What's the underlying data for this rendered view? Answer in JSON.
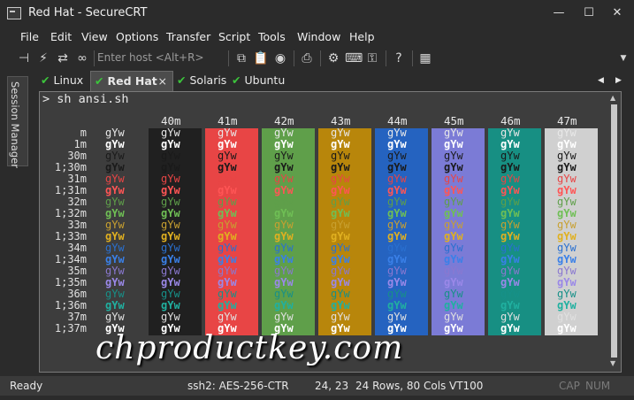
{
  "window": {
    "title": "Red Hat - SecureCRT"
  },
  "menu": [
    "File",
    "Edit",
    "View",
    "Options",
    "Transfer",
    "Script",
    "Tools",
    "Window",
    "Help"
  ],
  "toolbar": {
    "host_placeholder": "Enter host <Alt+R>"
  },
  "tabs": [
    {
      "label": "Linux",
      "active": false
    },
    {
      "label": "Red Hat",
      "active": true
    },
    {
      "label": "Solaris",
      "active": false
    },
    {
      "label": "Ubuntu",
      "active": false
    }
  ],
  "tab_close_glyph": "×",
  "side_panel": {
    "label": "Session Manager"
  },
  "terminal": {
    "prompt": "> sh ansi.sh",
    "sample": "gYw",
    "columns": [
      "40m",
      "41m",
      "42m",
      "43m",
      "44m",
      "45m",
      "46m",
      "47m"
    ],
    "column_colors": [
      "#202020",
      "#e84545",
      "#5f9f4a",
      "#b8860b",
      "#2563c0",
      "#7b7bd6",
      "#178f83",
      "#d0d0d0"
    ],
    "rows": [
      "m",
      "1m",
      "30m",
      "1;30m",
      "31m",
      "1;31m",
      "32m",
      "1;32m",
      "33m",
      "1;33m",
      "34m",
      "1;34m",
      "35m",
      "1;35m",
      "36m",
      "1;36m",
      "37m",
      "1;37m"
    ],
    "fg_colors": [
      "#e8e8e8",
      "#ffffff",
      "#1a1a1a",
      "#1a1a1a",
      "#e84545",
      "#ff5555",
      "#5f9f4a",
      "#6fbf55",
      "#c8a030",
      "#e0b020",
      "#2a70d0",
      "#3a80e8",
      "#8a78d0",
      "#9a88e8",
      "#179088",
      "#20b0a0",
      "#e0e0e0",
      "#ffffff"
    ]
  },
  "watermark": "chproductkey.com",
  "status": {
    "ready": "Ready",
    "cipher": "ssh2: AES-256-CTR",
    "cursor": "24,  23",
    "size": "24 Rows, 80 Cols",
    "emulation": "VT100",
    "cap": "CAP",
    "num": "NUM"
  }
}
